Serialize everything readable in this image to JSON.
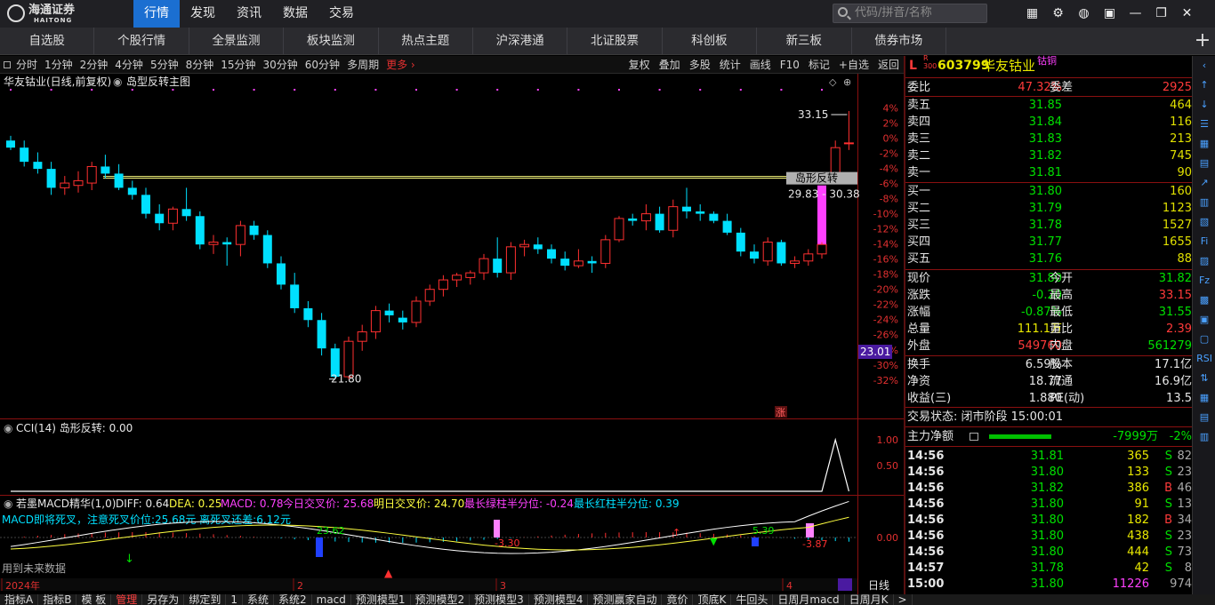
{
  "top": {
    "logo_cn": "海通证券",
    "logo_en": "HAITONG",
    "menu": [
      "行情",
      "发现",
      "资讯",
      "数据",
      "交易"
    ],
    "active_menu": "行情",
    "search_placeholder": "代码/拼音/名称",
    "icons": [
      "grid-icon",
      "gear-icon",
      "globe-icon",
      "chat-icon",
      "minimize-icon",
      "restore-icon",
      "close-icon"
    ]
  },
  "nav_tabs": [
    "自选股",
    "个股行情",
    "全景监测",
    "板块监测",
    "热点主题",
    "沪深港通",
    "北证股票",
    "科创板",
    "新三板",
    "债券市场"
  ],
  "period_bar": {
    "periods": [
      "分时",
      "1分钟",
      "2分钟",
      "4分钟",
      "5分钟",
      "8分钟",
      "15分钟",
      "30分钟",
      "60分钟",
      "多周期",
      "更多 ›"
    ],
    "tools": [
      "复权",
      "叠加",
      "多股",
      "统计",
      "画线",
      "F10",
      "标记",
      "+自选",
      "返回"
    ]
  },
  "main_chart": {
    "title": "华友钴业(日线,前复权)",
    "indicator": "岛型反转主图",
    "high_label": "33.15",
    "low_label": "21.80",
    "range_label": "29.83 - 30.38",
    "tag_label": "岛形反转",
    "price_tag": "23.01",
    "zhang_tag": "涨",
    "axis_pct": [
      "4%",
      "2%",
      "0%",
      "-2%",
      "-4%",
      "-6%",
      "-8%",
      "-10%",
      "-12%",
      "-14%",
      "-16%",
      "-18%",
      "-20%",
      "-22%",
      "-24%",
      "-26%",
      "-28%",
      "-30%",
      "-32%"
    ],
    "axis_pct_values": [
      4,
      2,
      0,
      -2,
      -4,
      -6,
      -8,
      -10,
      -12,
      -14,
      -16,
      -18,
      -20,
      -22,
      -24,
      -26,
      -28,
      -30,
      -32
    ],
    "colors": {
      "up": "#ff3030",
      "down": "#00e0ff",
      "island": "#ff40ff",
      "band": "#ffff80"
    }
  },
  "chart_data": {
    "type": "candlestick",
    "series": [
      {
        "o": 31.9,
        "h": 32.1,
        "l": 31.5,
        "c": 31.6
      },
      {
        "o": 31.6,
        "h": 31.9,
        "l": 30.8,
        "c": 31.0
      },
      {
        "o": 31.0,
        "h": 31.4,
        "l": 30.5,
        "c": 30.7
      },
      {
        "o": 30.7,
        "h": 31.0,
        "l": 29.6,
        "c": 29.9
      },
      {
        "o": 29.9,
        "h": 30.4,
        "l": 29.6,
        "c": 30.1
      },
      {
        "o": 30.0,
        "h": 30.6,
        "l": 29.7,
        "c": 30.2
      },
      {
        "o": 30.1,
        "h": 31.0,
        "l": 29.8,
        "c": 30.8
      },
      {
        "o": 30.8,
        "h": 31.3,
        "l": 30.3,
        "c": 30.5
      },
      {
        "o": 30.5,
        "h": 30.9,
        "l": 29.8,
        "c": 29.9
      },
      {
        "o": 29.9,
        "h": 30.2,
        "l": 29.4,
        "c": 29.6
      },
      {
        "o": 29.6,
        "h": 29.9,
        "l": 28.6,
        "c": 28.8
      },
      {
        "o": 28.8,
        "h": 29.2,
        "l": 28.1,
        "c": 28.4
      },
      {
        "o": 28.4,
        "h": 29.1,
        "l": 28.1,
        "c": 29.0
      },
      {
        "o": 29.0,
        "h": 29.9,
        "l": 28.5,
        "c": 28.7
      },
      {
        "o": 28.7,
        "h": 28.9,
        "l": 27.3,
        "c": 27.5
      },
      {
        "o": 27.5,
        "h": 27.9,
        "l": 27.1,
        "c": 27.6
      },
      {
        "o": 27.6,
        "h": 27.8,
        "l": 26.6,
        "c": 27.5
      },
      {
        "o": 27.5,
        "h": 28.5,
        "l": 27.0,
        "c": 28.3
      },
      {
        "o": 28.3,
        "h": 28.5,
        "l": 27.7,
        "c": 27.9
      },
      {
        "o": 27.9,
        "h": 28.1,
        "l": 26.5,
        "c": 26.7
      },
      {
        "o": 26.7,
        "h": 27.0,
        "l": 25.6,
        "c": 25.8
      },
      {
        "o": 25.8,
        "h": 26.3,
        "l": 24.6,
        "c": 24.8
      },
      {
        "o": 24.8,
        "h": 25.1,
        "l": 24.0,
        "c": 24.3
      },
      {
        "o": 24.3,
        "h": 24.6,
        "l": 22.8,
        "c": 23.1
      },
      {
        "o": 23.1,
        "h": 23.3,
        "l": 21.8,
        "c": 21.9
      },
      {
        "o": 21.9,
        "h": 23.6,
        "l": 21.8,
        "c": 23.4
      },
      {
        "o": 23.4,
        "h": 24.1,
        "l": 23.0,
        "c": 23.8
      },
      {
        "o": 23.8,
        "h": 24.9,
        "l": 23.5,
        "c": 24.7
      },
      {
        "o": 24.7,
        "h": 25.0,
        "l": 24.2,
        "c": 24.5
      },
      {
        "o": 24.4,
        "h": 24.7,
        "l": 23.9,
        "c": 24.2
      },
      {
        "o": 24.2,
        "h": 25.3,
        "l": 24.0,
        "c": 25.1
      },
      {
        "o": 25.1,
        "h": 25.8,
        "l": 24.9,
        "c": 25.6
      },
      {
        "o": 25.6,
        "h": 26.2,
        "l": 25.3,
        "c": 26.0
      },
      {
        "o": 26.0,
        "h": 26.3,
        "l": 25.7,
        "c": 26.2
      },
      {
        "o": 26.1,
        "h": 26.4,
        "l": 25.8,
        "c": 26.3
      },
      {
        "o": 26.3,
        "h": 27.1,
        "l": 26.0,
        "c": 26.9
      },
      {
        "o": 26.9,
        "h": 27.8,
        "l": 26.1,
        "c": 26.3
      },
      {
        "o": 26.3,
        "h": 27.6,
        "l": 26.0,
        "c": 27.4
      },
      {
        "o": 27.4,
        "h": 27.7,
        "l": 27.0,
        "c": 27.5
      },
      {
        "o": 27.5,
        "h": 27.8,
        "l": 27.1,
        "c": 27.3
      },
      {
        "o": 27.3,
        "h": 27.5,
        "l": 26.7,
        "c": 26.9
      },
      {
        "o": 26.9,
        "h": 27.2,
        "l": 26.4,
        "c": 26.6
      },
      {
        "o": 26.6,
        "h": 27.3,
        "l": 26.5,
        "c": 26.8
      },
      {
        "o": 26.8,
        "h": 27.0,
        "l": 26.3,
        "c": 26.7
      },
      {
        "o": 26.7,
        "h": 27.9,
        "l": 26.5,
        "c": 27.7
      },
      {
        "o": 27.7,
        "h": 28.7,
        "l": 27.6,
        "c": 28.6
      },
      {
        "o": 28.6,
        "h": 28.8,
        "l": 28.3,
        "c": 28.5
      },
      {
        "o": 28.5,
        "h": 29.2,
        "l": 28.1,
        "c": 28.8
      },
      {
        "o": 28.8,
        "h": 29.1,
        "l": 28.0,
        "c": 28.1
      },
      {
        "o": 28.1,
        "h": 29.4,
        "l": 27.8,
        "c": 29.1
      },
      {
        "o": 29.1,
        "h": 29.9,
        "l": 28.6,
        "c": 28.9
      },
      {
        "o": 28.9,
        "h": 29.2,
        "l": 28.5,
        "c": 28.8
      },
      {
        "o": 28.8,
        "h": 28.9,
        "l": 28.4,
        "c": 28.5
      },
      {
        "o": 28.5,
        "h": 28.8,
        "l": 27.9,
        "c": 28.0
      },
      {
        "o": 28.0,
        "h": 28.2,
        "l": 27.0,
        "c": 27.2
      },
      {
        "o": 27.2,
        "h": 27.5,
        "l": 26.7,
        "c": 26.9
      },
      {
        "o": 26.8,
        "h": 27.8,
        "l": 26.6,
        "c": 27.6
      },
      {
        "o": 27.6,
        "h": 27.7,
        "l": 26.6,
        "c": 26.7
      },
      {
        "o": 26.7,
        "h": 27.0,
        "l": 26.5,
        "c": 26.8
      },
      {
        "o": 26.8,
        "h": 27.3,
        "l": 26.6,
        "c": 27.1
      },
      {
        "o": 27.1,
        "h": 27.6,
        "l": 26.9,
        "c": 27.5
      },
      {
        "o": 30.2,
        "h": 31.9,
        "l": 30.2,
        "c": 31.6
      },
      {
        "o": 31.8,
        "h": 33.15,
        "l": 31.5,
        "c": 31.8
      }
    ],
    "island_bar": {
      "index": 60,
      "low": 27.4,
      "high": 30.0
    },
    "band_price": [
      29.83,
      30.38
    ],
    "xlabels": [
      "2024年",
      "2",
      "3",
      "4"
    ],
    "ylim": [
      21.0,
      33.6
    ]
  },
  "cci": {
    "title": "CCI(14) 岛形反转: 0.00",
    "axis": [
      "1.00",
      "0.50"
    ],
    "values": [
      0,
      0,
      0,
      0,
      0,
      0,
      0,
      0,
      0,
      0,
      0,
      0,
      0,
      0,
      0,
      0,
      0,
      0,
      0,
      0,
      0,
      0,
      0,
      0,
      0,
      0,
      0,
      0,
      0,
      0,
      0,
      0,
      0,
      0,
      0,
      0,
      0,
      0,
      0,
      0,
      0,
      0,
      0,
      0,
      0,
      0,
      0,
      0,
      0,
      0,
      0,
      0,
      0,
      0,
      0,
      0,
      0,
      0,
      0,
      0,
      0,
      1,
      0
    ]
  },
  "macd": {
    "title": "若墨MACD精华(1,0)",
    "diff": "DIFF: 0.64",
    "dea": "DEA: 0.25",
    "macd": "MACD: 0.78",
    "today_cross": "今日交叉价: 25.68",
    "tomorrow_cross": "明日交叉价: 24.70",
    "green_half": "最长绿柱半分位: -0.24",
    "red_half": "最长红柱半分位: 0.39",
    "line2": "MACD即将死叉，注意死叉价位:25.68元  离死叉还差:6.12元",
    "future_note": "用到未来数据",
    "labels": {
      "a": "23.62",
      "b": "-3.30",
      "c": "5.39",
      "d": "-3.87"
    },
    "axis_zero": "0.00",
    "period": "日线",
    "xlabels": [
      "2024年",
      "2",
      "3",
      "4"
    ]
  },
  "quote": {
    "code": "603799",
    "name": "华友钴业",
    "tag": "钴铜",
    "r300": "R\n300",
    "L": "L",
    "weibi_label": "委比",
    "weibi": "47.32%",
    "weicha_label": "委差",
    "weicha": "2925",
    "sells": [
      {
        "label": "卖五",
        "price": "31.85",
        "vol": "464"
      },
      {
        "label": "卖四",
        "price": "31.84",
        "vol": "116"
      },
      {
        "label": "卖三",
        "price": "31.83",
        "vol": "213"
      },
      {
        "label": "卖二",
        "price": "31.82",
        "vol": "745"
      },
      {
        "label": "卖一",
        "price": "31.81",
        "vol": "90"
      }
    ],
    "buys": [
      {
        "label": "买一",
        "price": "31.80",
        "vol": "160"
      },
      {
        "label": "买二",
        "price": "31.79",
        "vol": "1123"
      },
      {
        "label": "买三",
        "price": "31.78",
        "vol": "1527"
      },
      {
        "label": "买四",
        "price": "31.77",
        "vol": "1655"
      },
      {
        "label": "买五",
        "price": "31.76",
        "vol": "88"
      }
    ],
    "stats": [
      {
        "l1": "现价",
        "v1": "31.80",
        "c1": "green",
        "l2": "今开",
        "v2": "31.82",
        "c2": "green"
      },
      {
        "l1": "涨跌",
        "v1": "-0.20",
        "c1": "green",
        "l2": "最高",
        "v2": "33.15",
        "c2": "red"
      },
      {
        "l1": "涨幅",
        "v1": "-0.87%",
        "c1": "green",
        "l2": "最低",
        "v2": "31.55",
        "c2": "green"
      },
      {
        "l1": "总量",
        "v1": "111.1万",
        "c1": "yellow",
        "l2": "量比",
        "v2": "2.39",
        "c2": "red"
      },
      {
        "l1": "外盘",
        "v1": "549760",
        "c1": "red",
        "l2": "内盘",
        "v2": "561279",
        "c2": "green"
      }
    ],
    "stats2": [
      {
        "l1": "换手",
        "v1": "6.59%",
        "l2": "股本",
        "v2": "17.1亿"
      },
      {
        "l1": "净资",
        "v1": "18.77",
        "l2": "流通",
        "v2": "16.9亿"
      },
      {
        "l1": "收益(三)",
        "v1": "1.880",
        "l2": "PE(动)",
        "v2": "13.5"
      }
    ],
    "trade_status": "交易状态: 闭市阶段 15:00:01",
    "main_flow_label": "主力净额",
    "main_flow": "-7999万",
    "main_flow_pct": "-2%",
    "ticks": [
      {
        "t": "14:56",
        "p": "31.81",
        "v": "365",
        "d": "S",
        "n": "82"
      },
      {
        "t": "14:56",
        "p": "31.80",
        "v": "133",
        "d": "S",
        "n": "23"
      },
      {
        "t": "14:56",
        "p": "31.82",
        "v": "386",
        "d": "B",
        "n": "46"
      },
      {
        "t": "14:56",
        "p": "31.80",
        "v": "91",
        "d": "S",
        "n": "13"
      },
      {
        "t": "14:56",
        "p": "31.80",
        "v": "182",
        "d": "B",
        "n": "34"
      },
      {
        "t": "14:56",
        "p": "31.80",
        "v": "438",
        "d": "S",
        "n": "23"
      },
      {
        "t": "14:56",
        "p": "31.80",
        "v": "444",
        "d": "S",
        "n": "73"
      },
      {
        "t": "14:57",
        "p": "31.78",
        "v": "42",
        "d": "S",
        "n": "8"
      },
      {
        "t": "15:00",
        "p": "31.80",
        "v": "11226",
        "d": "",
        "n": "974"
      }
    ]
  },
  "sidebar": [
    "‹",
    "↑",
    "↓",
    "☰",
    "▦",
    "▤",
    "↗",
    "▥",
    "▧",
    "Fi",
    "▨",
    "Fz",
    "▩",
    "▣",
    "▢",
    "RSI",
    "⇅",
    "▦",
    "▤",
    "▥"
  ],
  "bottom_tabs": [
    "指标A",
    "指标B",
    "模 板",
    "管理",
    "另存为",
    "绑定到",
    "1",
    "系统",
    "系统2",
    "macd",
    "预测模型1",
    "预测模型2",
    "预测模型3",
    "预测模型4",
    "预测赢家自动",
    "竟价",
    "顶底K",
    "牛回头",
    "日周月macd",
    "日周月K",
    ">"
  ],
  "bottom_active": "管理"
}
